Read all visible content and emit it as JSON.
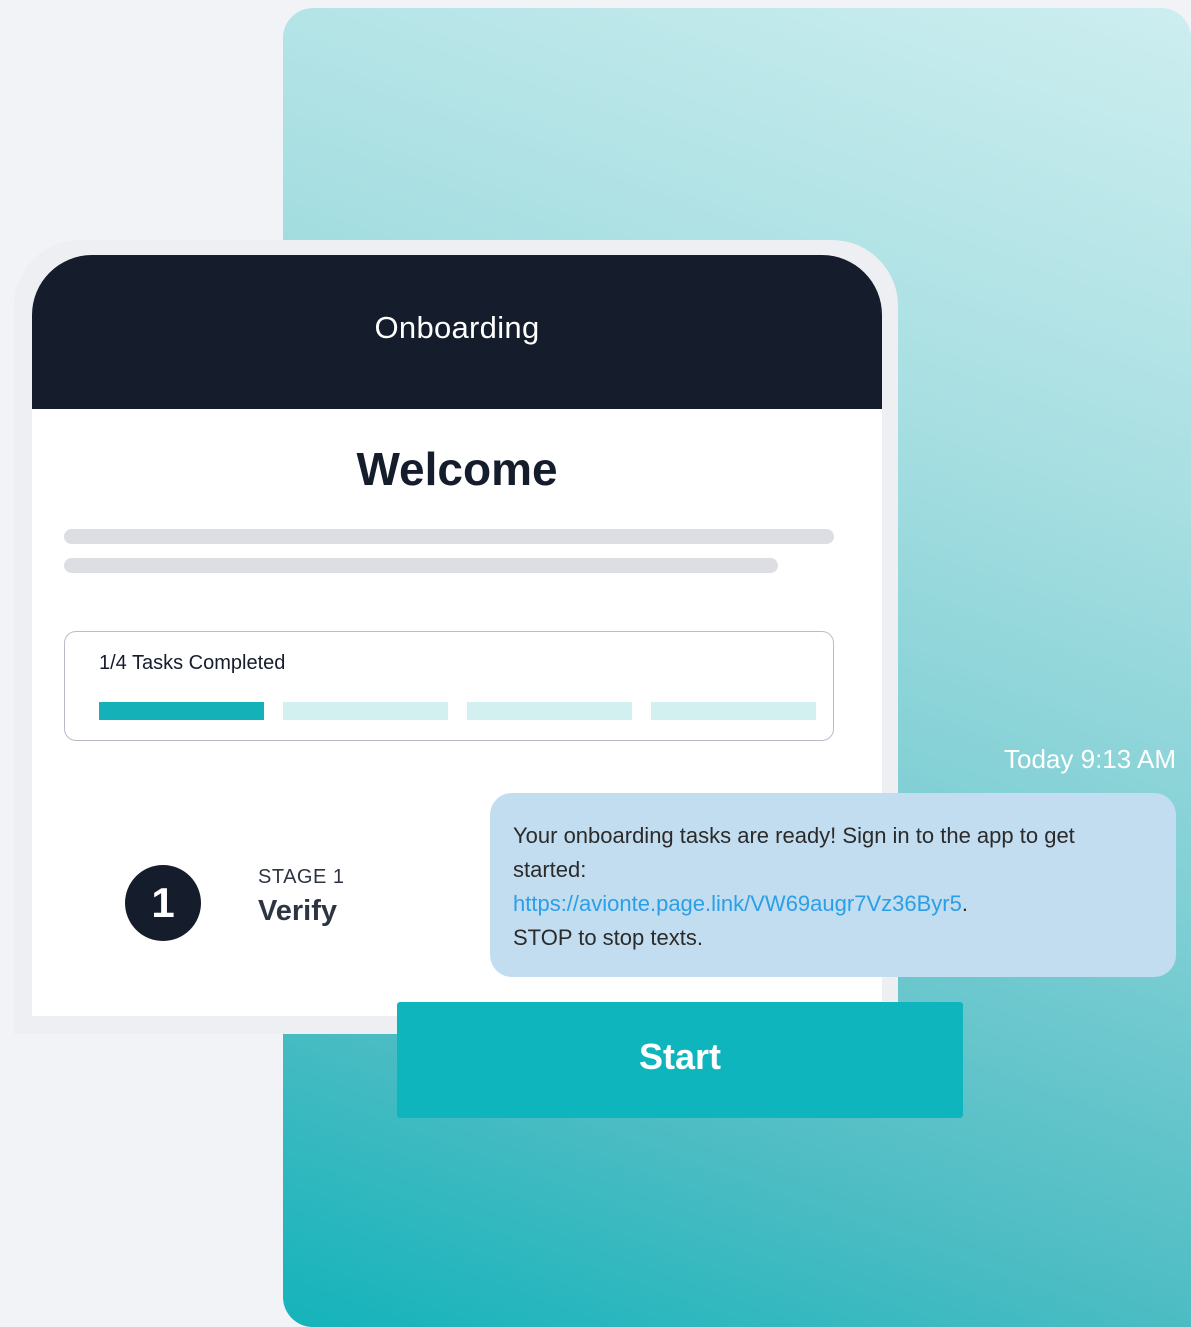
{
  "phone": {
    "header_title": "Onboarding",
    "welcome_title": "Welcome",
    "progress": {
      "label": "1/4 Tasks Completed",
      "completed": 1,
      "total": 4
    },
    "stage": {
      "number": "1",
      "label": "STAGE 1",
      "name": "Verify"
    },
    "start_button": "Start"
  },
  "message": {
    "timestamp": "Today 9:13 AM",
    "text_before_link": "Your onboarding tasks are ready! Sign in to the app to get started:",
    "link": "https://avionte.page.link/VW69augr7Vz36Byr5",
    "link_suffix": ".",
    "text_after_link": "STOP to stop texts."
  },
  "colors": {
    "header": "#151c2b",
    "accent": "#15b1b8",
    "progress_remaining": "#d3f0f1",
    "bubble": "#c2ddf0",
    "link": "#2a9fe8"
  }
}
